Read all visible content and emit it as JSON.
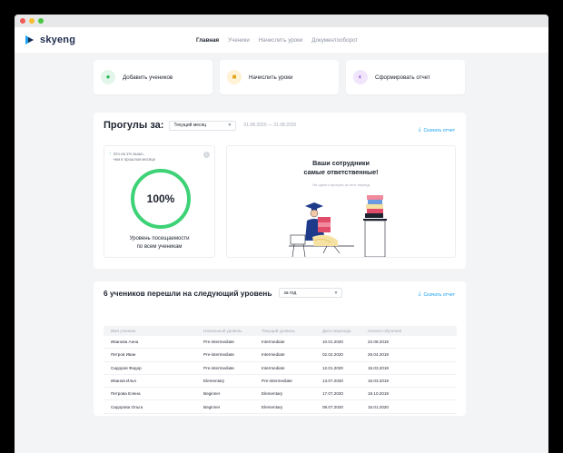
{
  "brand": {
    "name": "skyeng"
  },
  "nav": [
    {
      "label": "Главная",
      "active": true
    },
    {
      "label": "Ученики",
      "active": false
    },
    {
      "label": "Начислить уроки",
      "active": false
    },
    {
      "label": "Документооборот",
      "active": false
    }
  ],
  "actions": [
    {
      "label": "Добавить учеников",
      "icon": "add-students-icon",
      "color": "#2fb85a"
    },
    {
      "label": "Начислить уроки",
      "icon": "credit-lessons-icon",
      "color": "#e2a51b"
    },
    {
      "label": "Сформировать отчет",
      "icon": "report-icon",
      "color": "#9b57d6"
    }
  ],
  "absences": {
    "title": "Прогулы за:",
    "period_select": "Текущий месяц",
    "date_range": "01.08.2020 — 31.08.2020",
    "download_label": "Скачать отчет",
    "stat": {
      "note_line1": "Это на 1% выше,",
      "note_line2": "чем в прошлом месяце",
      "value": "100%",
      "progress": 1.0,
      "label_line1": "Уровень посещаемости",
      "label_line2": "по всем ученикам"
    },
    "praise": {
      "title_line1": "Ваши сотрудники",
      "title_line2": "самые ответственные!",
      "subtitle": "Ни одного прогула за этот период"
    }
  },
  "promotion": {
    "title": "6 учеников перешли на следующий уровень",
    "period_select": "за год",
    "download_label": "Скачать отчет",
    "columns": [
      "Имя ученика",
      "Начальный уровень",
      "Текущий уровень",
      "Дата перехода",
      "Начало обучения"
    ],
    "rows": [
      [
        "Иванова Анна",
        "Pre-intermediate",
        "Intermediate",
        "10.01.2020",
        "22.08.2019"
      ],
      [
        "Петров Иван",
        "Pre-intermediate",
        "Intermediate",
        "02.02.2020",
        "26.04.2019"
      ],
      [
        "Сидоров Федор",
        "Pre-intermediate",
        "Intermediate",
        "12.01.2020",
        "15.03.2019"
      ],
      [
        "Иванов Илья",
        "Elementary",
        "Pre-intermediate",
        "13.07.2020",
        "16.03.2019"
      ],
      [
        "Петрова Елена",
        "Beginner",
        "Elementary",
        "17.07.2020",
        "19.10.2019"
      ],
      [
        "Сидорова Ольга",
        "Beginner",
        "Elementary",
        "08.07.2020",
        "15.01.2020"
      ]
    ]
  }
}
